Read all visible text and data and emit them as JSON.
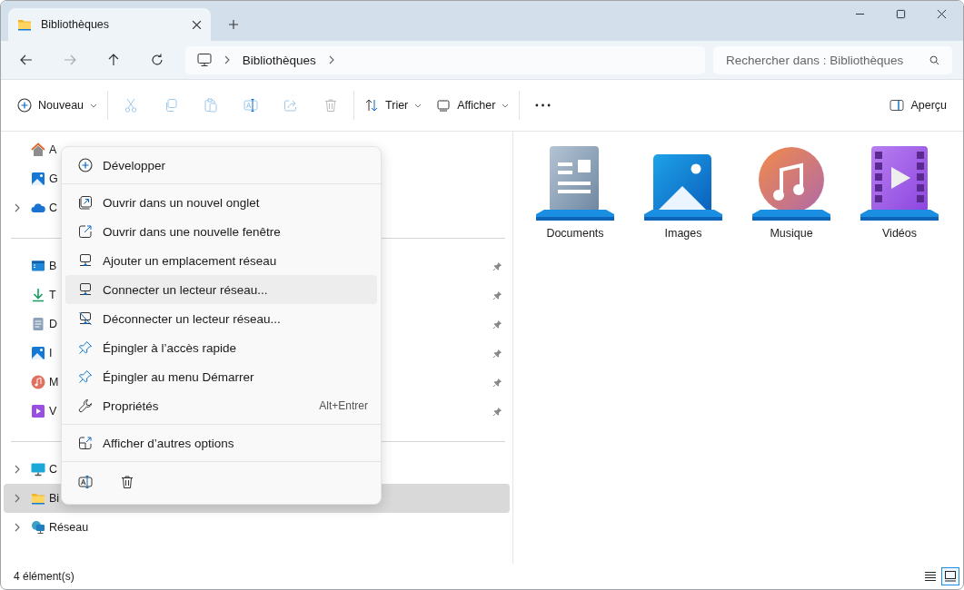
{
  "window": {
    "tab_title": "Bibliothèques"
  },
  "address_bar": {
    "crumbs": [
      "Bibliothèques"
    ]
  },
  "search": {
    "placeholder": "Rechercher dans : Bibliothèques"
  },
  "toolbar": {
    "items": [
      {
        "kind": "menu",
        "label": "Nouveau",
        "disabled": false
      },
      {
        "kind": "icon",
        "disabled": true
      },
      {
        "kind": "icon",
        "disabled": true
      },
      {
        "kind": "icon",
        "disabled": true
      },
      {
        "kind": "icon",
        "disabled": true
      },
      {
        "kind": "icon",
        "disabled": true
      },
      {
        "kind": "icon",
        "disabled": true
      },
      {
        "kind": "menu",
        "label": "Trier",
        "disabled": false
      },
      {
        "kind": "menu",
        "label": "Afficher",
        "disabled": false
      }
    ],
    "preview_label": "Aperçu"
  },
  "sidebar": {
    "sections": [
      [
        {
          "label": "A",
          "expandable": false,
          "pinned": false,
          "selected": false
        },
        {
          "label": "G",
          "expandable": false,
          "pinned": false,
          "selected": false
        },
        {
          "label": "C",
          "expandable": true,
          "pinned": false,
          "selected": false
        }
      ],
      [
        {
          "label": "B",
          "expandable": false,
          "pinned": true,
          "selected": false
        },
        {
          "label": "T",
          "expandable": false,
          "pinned": true,
          "selected": false
        },
        {
          "label": "D",
          "expandable": false,
          "pinned": true,
          "selected": false
        },
        {
          "label": "I",
          "expandable": false,
          "pinned": true,
          "selected": false
        },
        {
          "label": "M",
          "expandable": false,
          "pinned": true,
          "selected": false
        },
        {
          "label": "V",
          "expandable": false,
          "pinned": true,
          "selected": false
        }
      ],
      [
        {
          "label": "C",
          "expandable": true,
          "pinned": false,
          "selected": false
        },
        {
          "label": "Bi",
          "expandable": true,
          "pinned": false,
          "selected": true
        },
        {
          "label": "Réseau",
          "expandable": true,
          "pinned": false,
          "selected": false
        }
      ]
    ]
  },
  "libraries": [
    {
      "label": "Documents"
    },
    {
      "label": "Images"
    },
    {
      "label": "Musique"
    },
    {
      "label": "Vidéos"
    }
  ],
  "context_menu": {
    "items": [
      {
        "kind": "item",
        "label": "Développer",
        "highlighted": false
      },
      {
        "kind": "separator"
      },
      {
        "kind": "item",
        "label": "Ouvrir dans un nouvel onglet",
        "highlighted": false
      },
      {
        "kind": "item",
        "label": "Ouvrir dans une nouvelle fenêtre",
        "highlighted": false
      },
      {
        "kind": "item",
        "label": "Ajouter un emplacement réseau",
        "highlighted": false
      },
      {
        "kind": "item",
        "label": "Connecter un lecteur réseau...",
        "highlighted": true
      },
      {
        "kind": "item",
        "label": "Déconnecter un lecteur réseau...",
        "highlighted": false
      },
      {
        "kind": "item",
        "label": "Épingler à l’accès rapide",
        "highlighted": false
      },
      {
        "kind": "item",
        "label": "Épingler au menu Démarrer",
        "highlighted": false
      },
      {
        "kind": "item",
        "label": "Propriétés",
        "shortcut": "Alt+Entrer",
        "highlighted": false
      },
      {
        "kind": "separator"
      },
      {
        "kind": "item",
        "label": "Afficher d’autres options",
        "highlighted": false
      },
      {
        "kind": "separator"
      }
    ]
  },
  "status_bar": {
    "count": "4 élément(s)",
    "views": [
      {
        "kind": "details",
        "selected": false
      },
      {
        "kind": "large-icons",
        "selected": true
      }
    ]
  }
}
